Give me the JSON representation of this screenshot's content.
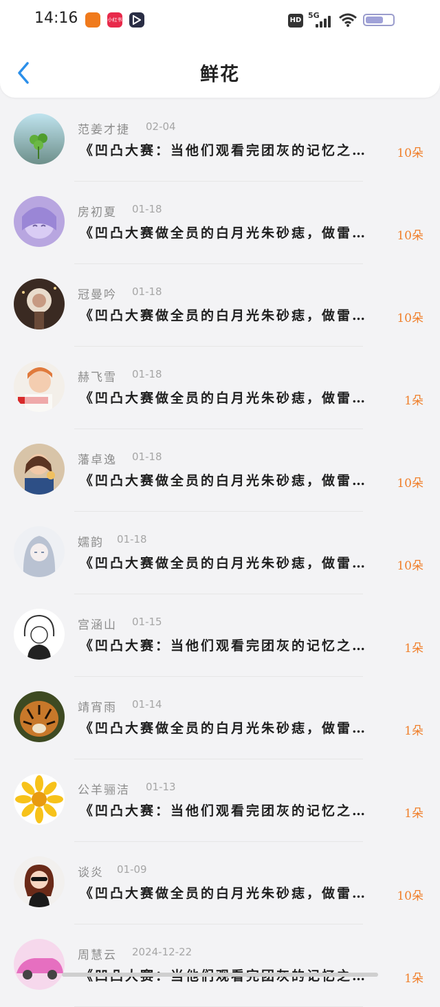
{
  "status_bar": {
    "time": "14:16",
    "network": "5G",
    "hd": "HD",
    "app_icons": [
      "weibo-app-icon",
      "xiaohongshu-app-icon",
      "play-app-icon"
    ],
    "xhs_label": "小红书"
  },
  "header": {
    "title": "鲜花"
  },
  "colors": {
    "accent_blue": "#2b8fea",
    "count_orange": "#f07f2a"
  },
  "items": [
    {
      "name": "范姜才捷",
      "date": "02-04",
      "message": "《凹凸大赛：当他们观看完团灰的记忆之…",
      "count": "10朵"
    },
    {
      "name": "房初夏",
      "date": "01-18",
      "message": "《凹凸大赛做全员的白月光朱砂痣，做雷…",
      "count": "10朵"
    },
    {
      "name": "冠曼吟",
      "date": "01-18",
      "message": "《凹凸大赛做全员的白月光朱砂痣，做雷…",
      "count": "10朵"
    },
    {
      "name": "赫飞雪",
      "date": "01-18",
      "message": "《凹凸大赛做全员的白月光朱砂痣，做雷…",
      "count": "1朵"
    },
    {
      "name": "藩卓逸",
      "date": "01-18",
      "message": "《凹凸大赛做全员的白月光朱砂痣，做雷…",
      "count": "10朵"
    },
    {
      "name": "嬬韵",
      "date": "01-18",
      "message": "《凹凸大赛做全员的白月光朱砂痣，做雷…",
      "count": "10朵"
    },
    {
      "name": "宫涵山",
      "date": "01-15",
      "message": "《凹凸大赛：当他们观看完团灰的记忆之…",
      "count": "1朵"
    },
    {
      "name": "靖宵雨",
      "date": "01-14",
      "message": "《凹凸大赛做全员的白月光朱砂痣，做雷…",
      "count": "1朵"
    },
    {
      "name": "公羊骊洁",
      "date": "01-13",
      "message": "《凹凸大赛：当他们观看完团灰的记忆之…",
      "count": "1朵"
    },
    {
      "name": "谈炎",
      "date": "01-09",
      "message": "《凹凸大赛做全员的白月光朱砂痣，做雷…",
      "count": "10朵"
    },
    {
      "name": "周慧云",
      "date": "2024-12-22",
      "message": "《凹凸大赛：当他们观看完团灰的记忆之…",
      "count": "1朵"
    }
  ]
}
